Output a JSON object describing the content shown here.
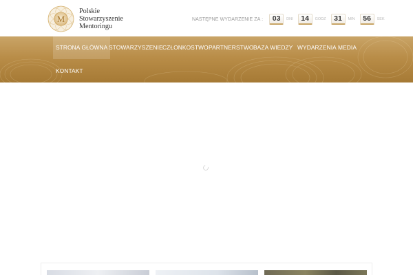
{
  "logo": {
    "emblem_letter": "M",
    "lines": [
      "Polskie",
      "Stowarzyszenie",
      "Mentoringu"
    ]
  },
  "countdown": {
    "label": "NASTĘPNE WYDARZENIE ZA :",
    "days": "03",
    "days_unit": "DNI",
    "hours": "14",
    "hours_unit": "GODZ",
    "minutes": "31",
    "minutes_unit": "MIN",
    "seconds": "56",
    "seconds_unit": "SEK"
  },
  "nav": {
    "items": [
      {
        "label": "STRONA GŁÓWNA",
        "active": true
      },
      {
        "label": "STOWARZYSZENIE",
        "active": false
      },
      {
        "label": "CZŁONKOSTWO",
        "active": false
      },
      {
        "label": "PARTNERSTWO",
        "active": false
      },
      {
        "label": "BAZA WIEDZY",
        "active": false
      },
      {
        "label": "WYDARZENIA",
        "active": false
      },
      {
        "label": "MEDIA",
        "active": false
      },
      {
        "label": "KONTAKT",
        "active": false
      }
    ]
  },
  "colors": {
    "gold_light": "#c9a467",
    "gold_dark": "#a67a35",
    "text_dark": "#333333"
  },
  "icons": {
    "loading": "spinner-icon"
  }
}
